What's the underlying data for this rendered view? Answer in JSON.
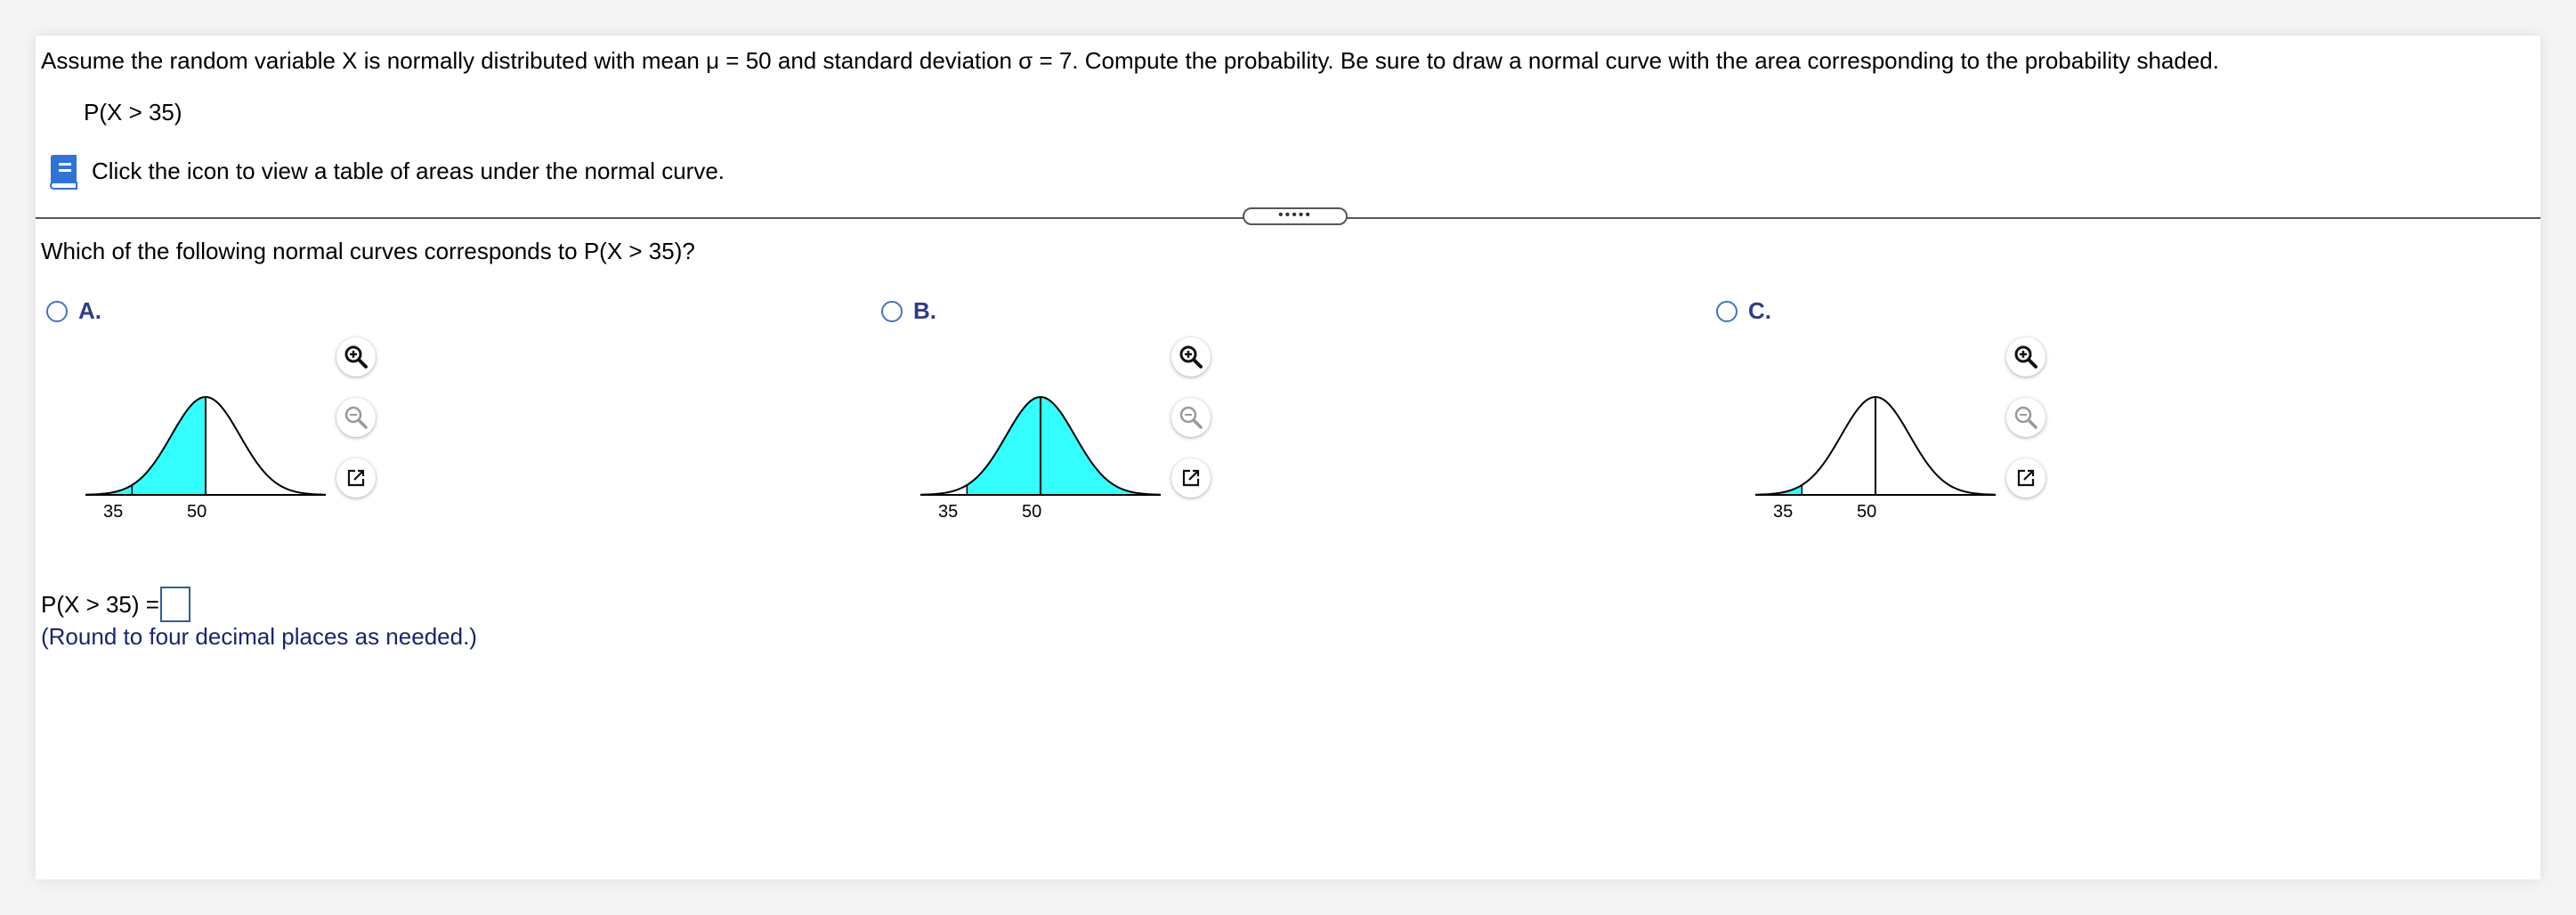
{
  "question": {
    "prompt": "Assume the random variable X is normally distributed with mean μ = 50 and standard deviation σ = 7. Compute the probability. Be sure to draw a normal curve with the area corresponding to the probability shaded.",
    "expression": "P(X > 35)",
    "table_link_text": "Click the icon to view a table of areas under the normal curve.",
    "handle_text": "•••••"
  },
  "part": {
    "which_curve": "Which of the following normal curves corresponds to P(X > 35)?",
    "options": [
      {
        "letter": "A.",
        "shade": "left-of-mean",
        "tick_labels": [
          "35",
          "50"
        ]
      },
      {
        "letter": "B.",
        "shade": "right-of-35",
        "tick_labels": [
          "35",
          "50"
        ]
      },
      {
        "letter": "C.",
        "shade": "left-of-35",
        "tick_labels": [
          "35",
          "50"
        ]
      }
    ],
    "tools": [
      "zoom-in-icon",
      "zoom-out-icon",
      "popout-icon"
    ]
  },
  "answer": {
    "label": "P(X > 35) =",
    "value": "",
    "hint": "(Round to four decimal places as needed.)"
  },
  "colors": {
    "shade": "#33ffff",
    "link_blue": "#2e3b8e",
    "radio": "#4472c4",
    "input_border": "#2d5f99"
  },
  "graph_axis": {
    "mean": 50,
    "sd": 7,
    "marked_value": 35
  }
}
